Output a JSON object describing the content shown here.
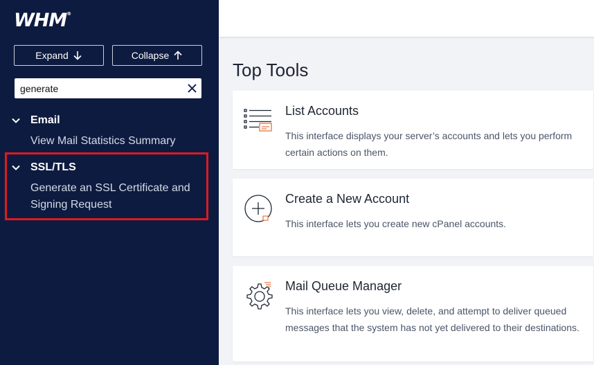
{
  "sidebar": {
    "logo": "WHM",
    "logo_mark": "®",
    "expand_label": "Expand",
    "collapse_label": "Collapse",
    "search": {
      "value": "generate",
      "placeholder": ""
    },
    "categories": [
      {
        "label": "Email",
        "items": [
          "View Mail Statistics Summary"
        ]
      },
      {
        "label": "SSL/TLS",
        "items": [
          "Generate an SSL Certificate and Signing Request"
        ]
      }
    ]
  },
  "main": {
    "title": "Top Tools",
    "tools": [
      {
        "title": "List Accounts",
        "description": "This interface displays your server’s accounts and lets you perform certain actions on them.",
        "icon": "list-accounts-icon"
      },
      {
        "title": "Create a New Account",
        "description": "This interface lets you create new cPanel accounts.",
        "icon": "create-account-icon"
      },
      {
        "title": "Mail Queue Manager",
        "description": "This interface lets you view, delete, and attempt to deliver queued messages that the system has not yet delivered to their destinations.",
        "icon": "mail-queue-gear-icon"
      }
    ]
  },
  "colors": {
    "sidebar_bg": "#0e1b40",
    "accent_orange": "#e8743b",
    "highlight_red": "#e0191e",
    "content_bg": "#f1f3f6"
  }
}
